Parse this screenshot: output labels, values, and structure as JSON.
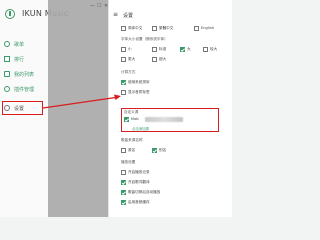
{
  "app": {
    "name": "IKUN Music"
  },
  "window": {
    "minimize": "—",
    "maximize": "☐",
    "close": "✕"
  },
  "sidebar": {
    "items": [
      {
        "label": "歌单"
      },
      {
        "label": "排行"
      },
      {
        "label": "我的列表"
      },
      {
        "label": "插件管理"
      },
      {
        "label": "设置"
      }
    ]
  },
  "settings": {
    "title": "设置",
    "language": {
      "options": [
        "简体中文",
        "繁體中文",
        "English"
      ]
    },
    "font_section": "字体大小设置（随系统字体）",
    "font_sizes": [
      "小",
      "标准",
      "大",
      "较大",
      "更大",
      "超大"
    ],
    "download_section": "计算方式",
    "download_options": [
      "使用系统排序",
      "显示音质标签"
    ],
    "source_section": "自定义源",
    "source_name": "Mob",
    "source_link": "点击添加源",
    "source_dir_section": "歌曲来源名称",
    "source_dir_options": [
      "原名",
      "别名"
    ],
    "play_section": "播放设置",
    "play_options": [
      "开启播放记录",
      "开启歌词翻译",
      "歌曲切换后自动播放",
      "启用音频缓存"
    ]
  },
  "colors": {
    "accent": "#3a9a6a",
    "highlight": "#d81e1e"
  }
}
